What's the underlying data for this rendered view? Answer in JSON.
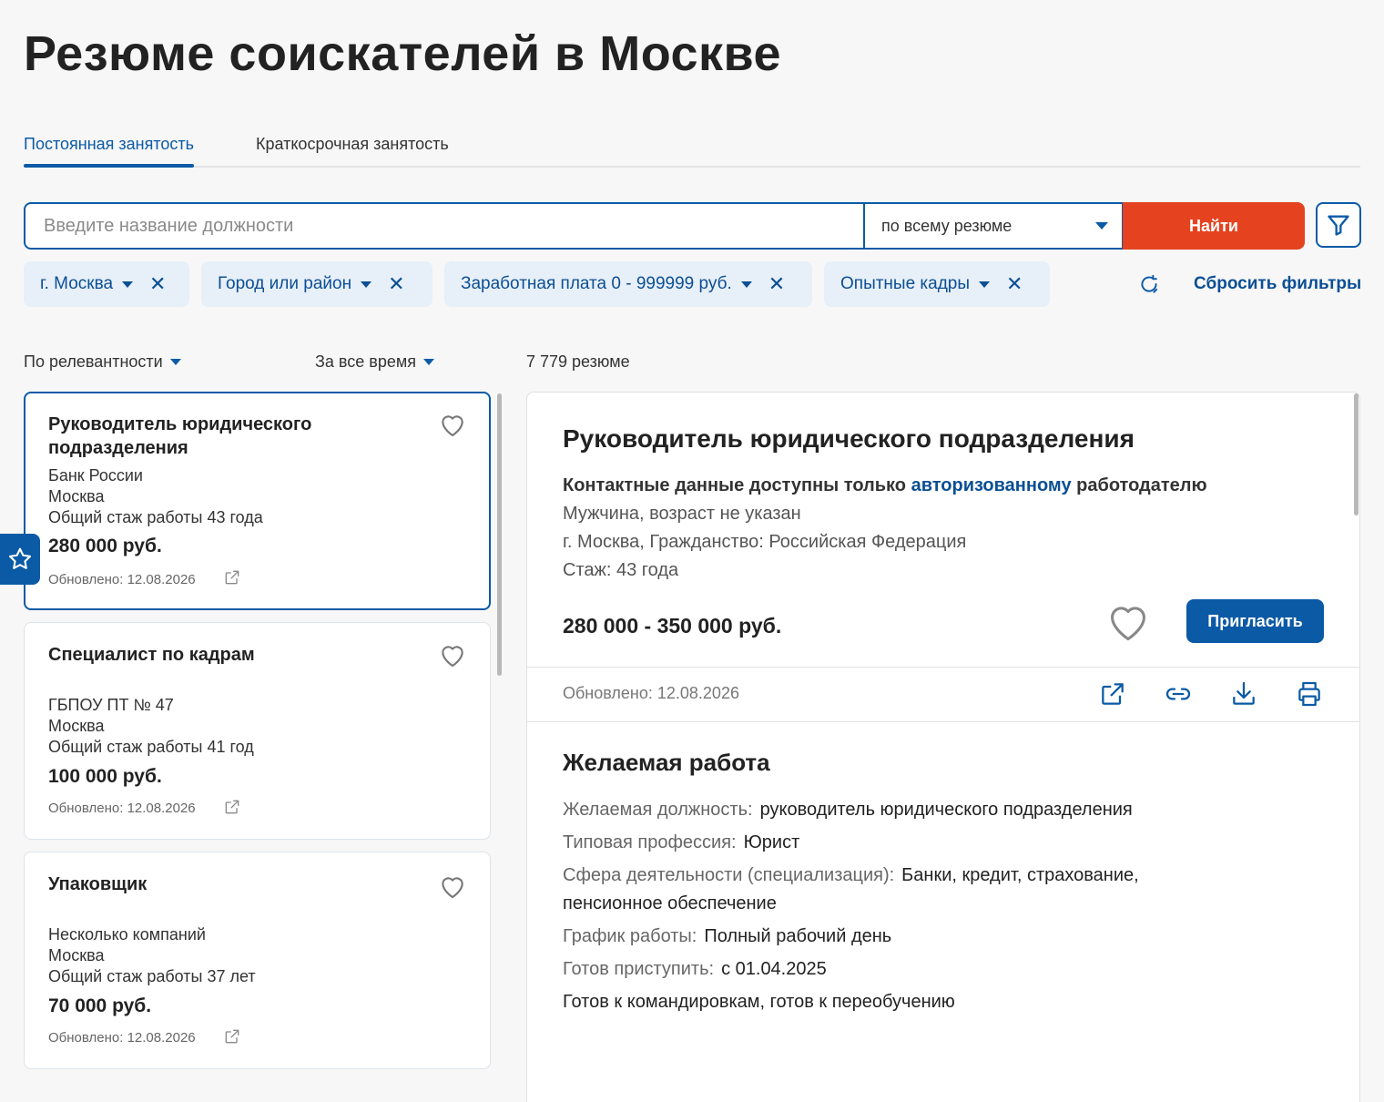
{
  "page": {
    "title": "Резюме соискателей в Москве"
  },
  "tabs": [
    {
      "label": "Постоянная занятость",
      "active": true
    },
    {
      "label": "Краткосрочная занятость",
      "active": false
    }
  ],
  "search": {
    "placeholder": "Введите название должности",
    "value": "",
    "scope": "по всему резюме",
    "button": "Найти"
  },
  "filters": {
    "chips": [
      {
        "label": "г. Москва"
      },
      {
        "label": "Город или район"
      },
      {
        "label": "Заработная плата 0 - 999999 руб."
      },
      {
        "label": "Опытные кадры"
      }
    ],
    "reset_label": "Сбросить фильтры"
  },
  "sorting": {
    "order": "По релевантности",
    "period": "За все время",
    "count": "7 779 резюме"
  },
  "list": {
    "items": [
      {
        "title": "Руководитель юридического подразделения",
        "company": "Банк России",
        "city": "Москва",
        "experience": "Общий стаж работы 43 года",
        "salary": "280 000 руб.",
        "updated": "Обновлено: 12.08.2026",
        "selected": true
      },
      {
        "title": "Специалист по кадрам",
        "company": "ГБПОУ ПТ № 47",
        "city": "Москва",
        "experience": "Общий стаж работы 41 год",
        "salary": "100 000 руб.",
        "updated": "Обновлено: 12.08.2026",
        "selected": false
      },
      {
        "title": "Упаковщик",
        "company": "Несколько компаний",
        "city": "Москва",
        "experience": "Общий стаж работы 37 лет",
        "salary": "70 000 руб.",
        "updated": "Обновлено: 12.08.2026",
        "selected": false
      }
    ]
  },
  "detail": {
    "title": "Руководитель юридического подразделения",
    "contact_prefix": "Контактные данные доступны только",
    "contact_link": "авторизованному",
    "contact_suffix": "работодателю",
    "gender_age": "Мужчина, возраст не указан",
    "location": "г. Москва, Гражданство: Российская Федерация",
    "experience": "Стаж: 43 года",
    "salary": "280 000 - 350 000 руб.",
    "invite_button": "Пригласить",
    "updated": "Обновлено: 12.08.2026",
    "desired": {
      "section_title": "Желаемая работа",
      "position_label": "Желаемая должность:",
      "position_value": "руководитель юридического подразделения",
      "profession_label": "Типовая профессия:",
      "profession_value": "Юрист",
      "sphere_label": "Сфера деятельности (специализация):",
      "sphere_value": "Банки, кредит, страхование,",
      "sphere_value_cont": "пенсионное обеспечение",
      "schedule_label": "График работы:",
      "schedule_value": "Полный рабочий день",
      "start_label": "Готов приступить:",
      "start_value": "с 01.04.2025",
      "extra": "Готов к командировкам, готов к переобучению"
    }
  },
  "colors": {
    "primary": "#0b5aa6",
    "accent": "#e5431f",
    "chip_bg": "#e7eff8"
  }
}
